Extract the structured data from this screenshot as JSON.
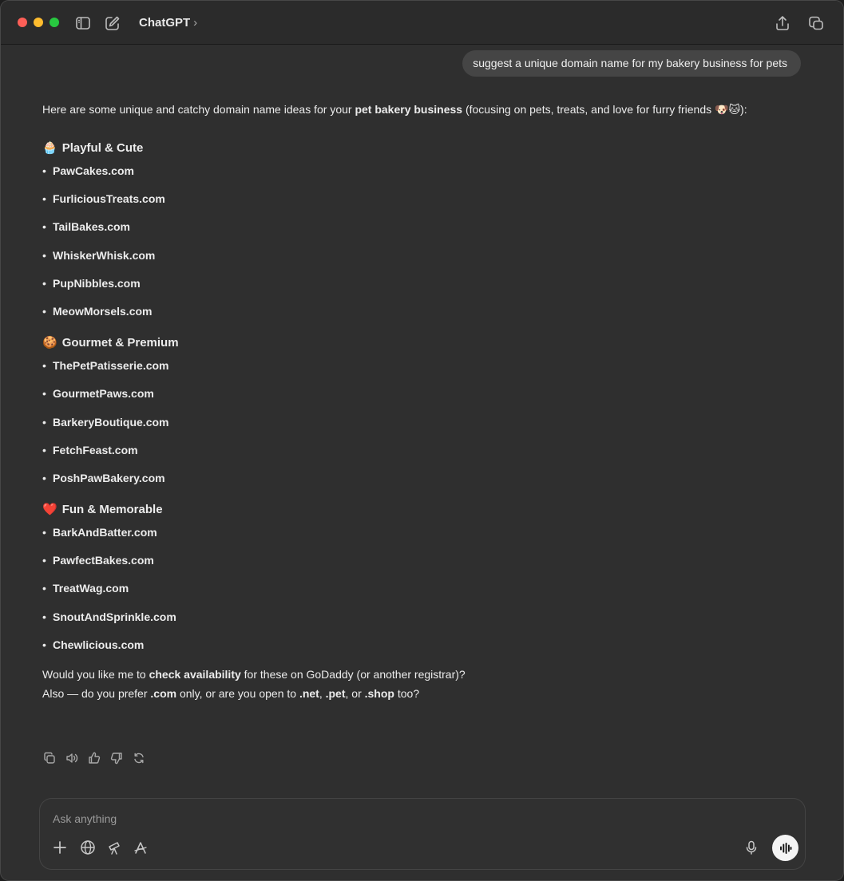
{
  "window": {
    "title": "ChatGPT",
    "title_chevron": "›"
  },
  "user_message": "suggest a unique domain name for my bakery business for pets",
  "response": {
    "intro_pre": "Here are some unique and catchy domain name ideas for your ",
    "intro_bold": "pet bakery business",
    "intro_post": " (focusing on pets, treats, and love for furry friends 🐶🐱):",
    "sections": [
      {
        "emoji": "🧁",
        "heading": "Playful & Cute",
        "items": [
          "PawCakes.com",
          "FurliciousTreats.com",
          "TailBakes.com",
          "WhiskerWhisk.com",
          "PupNibbles.com",
          "MeowMorsels.com"
        ]
      },
      {
        "emoji": "🍪",
        "heading": "Gourmet & Premium",
        "items": [
          "ThePetPatisserie.com",
          "GourmetPaws.com",
          "BarkeryBoutique.com",
          "FetchFeast.com",
          "PoshPawBakery.com"
        ]
      },
      {
        "emoji": "❤️",
        "heading": "Fun & Memorable",
        "items": [
          "BarkAndBatter.com",
          "PawfectBakes.com",
          "TreatWag.com",
          "SnoutAndSprinkle.com",
          "Chewlicious.com"
        ]
      }
    ],
    "closing_1_pre": "Would you like me to ",
    "closing_1_bold": "check availability",
    "closing_1_post": " for these on GoDaddy (or another registrar)?",
    "closing_2_a": "Also — do you prefer ",
    "closing_2_b": ".com",
    "closing_2_c": " only, or are you open to ",
    "closing_2_d": ".net",
    "closing_2_e": ", ",
    "closing_2_f": ".pet",
    "closing_2_g": ", or ",
    "closing_2_h": ".shop",
    "closing_2_i": " too?"
  },
  "composer": {
    "placeholder": "Ask anything"
  },
  "icons": {
    "sidebar": "sidebar-toggle-icon",
    "new_chat": "compose-icon",
    "share": "share-icon",
    "window": "new-window-icon",
    "copy": "copy-icon",
    "read_aloud": "speaker-icon",
    "thumbs_up": "thumbs-up-icon",
    "thumbs_down": "thumbs-down-icon",
    "regenerate": "refresh-icon",
    "attach": "plus-icon",
    "search": "globe-icon",
    "research": "telescope-icon",
    "tools": "tools-icon",
    "mic": "microphone-icon",
    "voice": "voice-mode-icon"
  },
  "bullet": "•"
}
